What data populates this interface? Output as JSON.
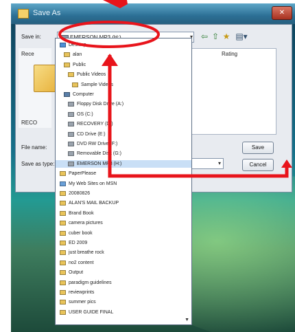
{
  "window": {
    "title": "Save As",
    "close_label": "✕"
  },
  "labels": {
    "save_in": "Save in:",
    "rating": "Rating",
    "file_name": "File name:",
    "save_as_type": "Save as type:"
  },
  "address": {
    "value": "EMERSON MP3 (H:)"
  },
  "toolbar": {
    "back": "⇦",
    "up": "⇧",
    "new_folder": "★",
    "views": "▤▾"
  },
  "left_items": [
    {
      "label": "Rece"
    },
    {
      "label": "RECO"
    }
  ],
  "buttons": {
    "save": "Save",
    "cancel": "Cancel"
  },
  "annotation": {
    "color": "#e8141b"
  },
  "dropdown": {
    "items": [
      {
        "label": "Desktop",
        "icon": "desktop-icon",
        "color": "#4d8fd6"
      },
      {
        "label": "alan",
        "icon": "user-folder-icon",
        "color": "#e8c35a"
      },
      {
        "label": "Public",
        "icon": "folder-icon",
        "color": "#e8c35a"
      },
      {
        "label": "Public Videos",
        "icon": "folder-icon",
        "color": "#e8c35a"
      },
      {
        "label": "Sample Videos",
        "icon": "folder-icon",
        "color": "#e8c35a"
      },
      {
        "label": "Computer",
        "icon": "computer-icon",
        "color": "#5a7fa8"
      },
      {
        "label": "Floppy Disk Drive (A:)",
        "icon": "floppy-icon",
        "color": "#9aa3ad"
      },
      {
        "label": "OS (C:)",
        "icon": "drive-icon",
        "color": "#9aa3ad"
      },
      {
        "label": "RECOVERY (D:)",
        "icon": "drive-icon",
        "color": "#9aa3ad"
      },
      {
        "label": "CD Drive (E:)",
        "icon": "cd-drive-icon",
        "color": "#9aa3ad"
      },
      {
        "label": "DVD RW Drive (F:)",
        "icon": "dvd-drive-icon",
        "color": "#9aa3ad"
      },
      {
        "label": "Removable Disk (G:)",
        "icon": "removable-drive-icon",
        "color": "#9aa3ad"
      },
      {
        "label": "EMERSON MP3 (H:)",
        "icon": "removable-drive-icon",
        "color": "#9aa3ad",
        "selected": true
      },
      {
        "label": "PaperPlease",
        "icon": "folder-icon",
        "color": "#e8c35a"
      },
      {
        "label": "My Web Sites on MSN",
        "icon": "web-folder-icon",
        "color": "#6aa0d8"
      },
      {
        "label": "20080826",
        "icon": "folder-icon",
        "color": "#e8c35a"
      },
      {
        "label": "ALAN'S MAIL BACKUP",
        "icon": "folder-icon",
        "color": "#e8c35a"
      },
      {
        "label": "Brand Book",
        "icon": "folder-icon",
        "color": "#e8c35a"
      },
      {
        "label": "camera pictures",
        "icon": "folder-icon",
        "color": "#e8c35a"
      },
      {
        "label": "cuber book",
        "icon": "folder-icon",
        "color": "#e8c35a"
      },
      {
        "label": "ED 2009",
        "icon": "folder-icon",
        "color": "#e8c35a"
      },
      {
        "label": "just breathe rock",
        "icon": "folder-icon",
        "color": "#e8c35a"
      },
      {
        "label": "no2 content",
        "icon": "folder-icon",
        "color": "#e8c35a"
      },
      {
        "label": "Output",
        "icon": "folder-icon",
        "color": "#e8c35a"
      },
      {
        "label": "paradigm guidelines",
        "icon": "folder-icon",
        "color": "#e8c35a"
      },
      {
        "label": "reviewprints",
        "icon": "folder-icon",
        "color": "#e8c35a"
      },
      {
        "label": "summer pics",
        "icon": "folder-icon",
        "color": "#e8c35a"
      },
      {
        "label": "USER GUIDE FINAL",
        "icon": "folder-icon",
        "color": "#e8c35a"
      }
    ],
    "scroll_indicator": "▼"
  },
  "edge_letter": "R"
}
